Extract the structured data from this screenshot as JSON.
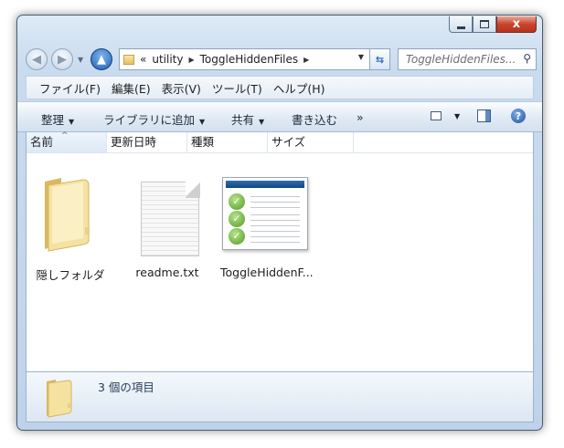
{
  "window": {
    "caption_buttons": {
      "minimize": "—",
      "maximize": "□",
      "close": "x"
    }
  },
  "nav": {
    "back_glyph": "◀",
    "forward_glyph": "▶",
    "up_glyph": "▲"
  },
  "address": {
    "chevrons": "«",
    "crumbs": [
      "utility",
      "ToggleHiddenFiles"
    ]
  },
  "search": {
    "placeholder": "ToggleHiddenFiles..."
  },
  "menu": [
    "ファイル(F)",
    "編集(E)",
    "表示(V)",
    "ツール(T)",
    "ヘルプ(H)"
  ],
  "toolbar": {
    "organize": "整理",
    "add_to_library": "ライブラリに追加",
    "share": "共有",
    "burn": "書き込む",
    "more": "»"
  },
  "columns": [
    "名前",
    "更新日時",
    "種類",
    "サイズ"
  ],
  "files": [
    {
      "name": "隠しフォルダ",
      "type": "folder"
    },
    {
      "name": "readme.txt",
      "type": "text"
    },
    {
      "name": "ToggleHiddenF...",
      "type": "app"
    }
  ],
  "details": {
    "count_text": "3 個の項目"
  },
  "icons": {
    "folder": "folder-icon",
    "text_file": "text-file-icon",
    "app": "checklist-app-icon",
    "search": "search-icon",
    "refresh": "refresh-icon",
    "help": "help-icon"
  },
  "colors": {
    "frame": "#c9dbee",
    "folder": "#f2d98a",
    "check": "#5aa02c",
    "close_button": "#c8442c"
  }
}
